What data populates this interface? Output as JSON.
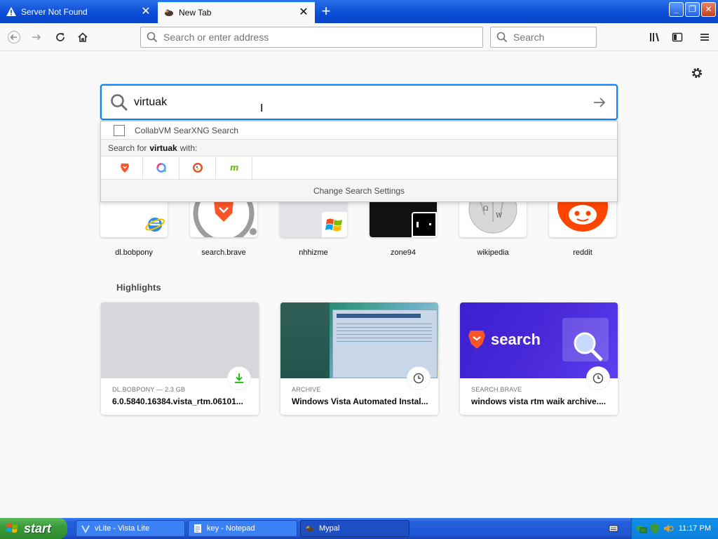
{
  "browser": {
    "tabs": [
      {
        "label": "Server Not Found",
        "icon": "warning-icon",
        "active": false
      },
      {
        "label": "New Tab",
        "icon": "mypal-icon",
        "active": true
      }
    ],
    "new_tab_symbol": "+",
    "address_placeholder": "Search or enter address",
    "search_placeholder": "Search"
  },
  "newtab": {
    "search_value": "virtuak",
    "dropdown": {
      "suggestion": "CollabVM SearXNG Search",
      "search_for_prefix": "Search for",
      "search_for_term": "virtuak",
      "search_for_suffix": "with:",
      "engines": [
        "brave-icon",
        "qwant-icon",
        "duckduckgo-icon",
        "mojeek-icon"
      ],
      "settings": "Change Search Settings"
    },
    "top_sites": [
      {
        "name": "dl.bobpony",
        "icon": "ie-icon"
      },
      {
        "name": "search.brave",
        "icon": "brave-icon"
      },
      {
        "name": "nhhizme",
        "icon": "windows-icon"
      },
      {
        "name": "zone94",
        "icon": "zone-icon"
      },
      {
        "name": "wikipedia",
        "icon": "wikipedia-icon"
      },
      {
        "name": "reddit",
        "icon": "reddit-icon"
      }
    ],
    "highlights_title": "Highlights",
    "highlights": [
      {
        "context": "DL.BOBPONY — 2.3 GB",
        "title": "6.0.5840.16384.vista_rtm.06101...",
        "badge": "download-icon"
      },
      {
        "context": "ARCHIVE",
        "title": "Windows Vista Automated Instal...",
        "badge": "clock-icon"
      },
      {
        "context": "SEARCH.BRAVE",
        "title": "windows vista rtm waik archive....",
        "badge": "clock-icon",
        "banner_text": "search"
      }
    ]
  },
  "taskbar": {
    "start_label": "start",
    "tasks": [
      {
        "label": "vLite - Vista Lite",
        "active": false
      },
      {
        "label": "key - Notepad",
        "active": false
      },
      {
        "label": "Mypal",
        "active": true
      }
    ],
    "clock": "11:17 PM"
  },
  "colors": {
    "accent": "#0a84ff",
    "titlebar": "#0a4cd6",
    "brave": "#fb542b",
    "reddit": "#ff4500",
    "download": "#12bc00"
  }
}
